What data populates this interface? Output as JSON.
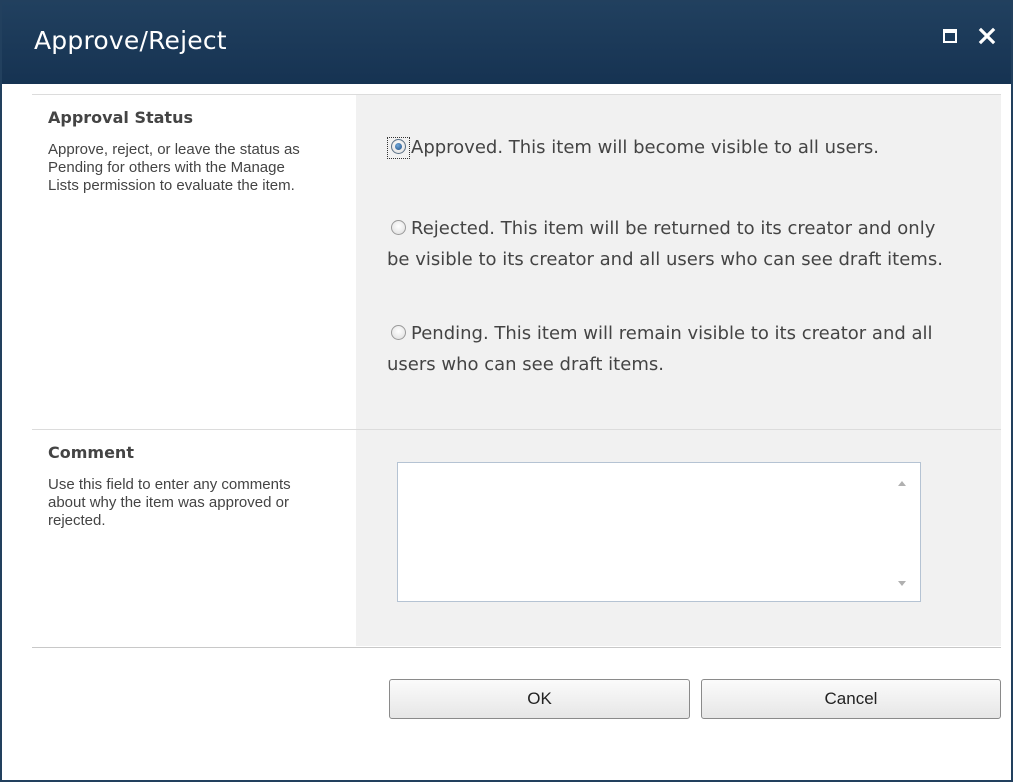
{
  "dialog": {
    "title": "Approve/Reject"
  },
  "approval": {
    "label": "Approval Status",
    "description": "Approve, reject, or leave the status as Pending for others with the Manage Lists permission to evaluate the item.",
    "options": [
      {
        "label": "Approved. This item will become visible to all users.",
        "checked": true
      },
      {
        "label": "Rejected. This item will be returned to its creator and only be visible to its creator and all users who can see draft items.",
        "checked": false
      },
      {
        "label": "Pending. This item will remain visible to its creator and all users who can see draft items.",
        "checked": false
      }
    ]
  },
  "comment": {
    "label": "Comment",
    "description": "Use this field to enter any comments about why the item was approved or rejected.",
    "value": ""
  },
  "buttons": {
    "ok": "OK",
    "cancel": "Cancel"
  },
  "icons": {
    "maximize": "maximize-icon",
    "close": "close-icon",
    "radio_checked": "radio-checked-icon",
    "radio_unchecked": "radio-unchecked-icon"
  },
  "colors": {
    "titlebar": "#1c3a58",
    "panel": "#f1f1f1",
    "text": "#444444"
  }
}
